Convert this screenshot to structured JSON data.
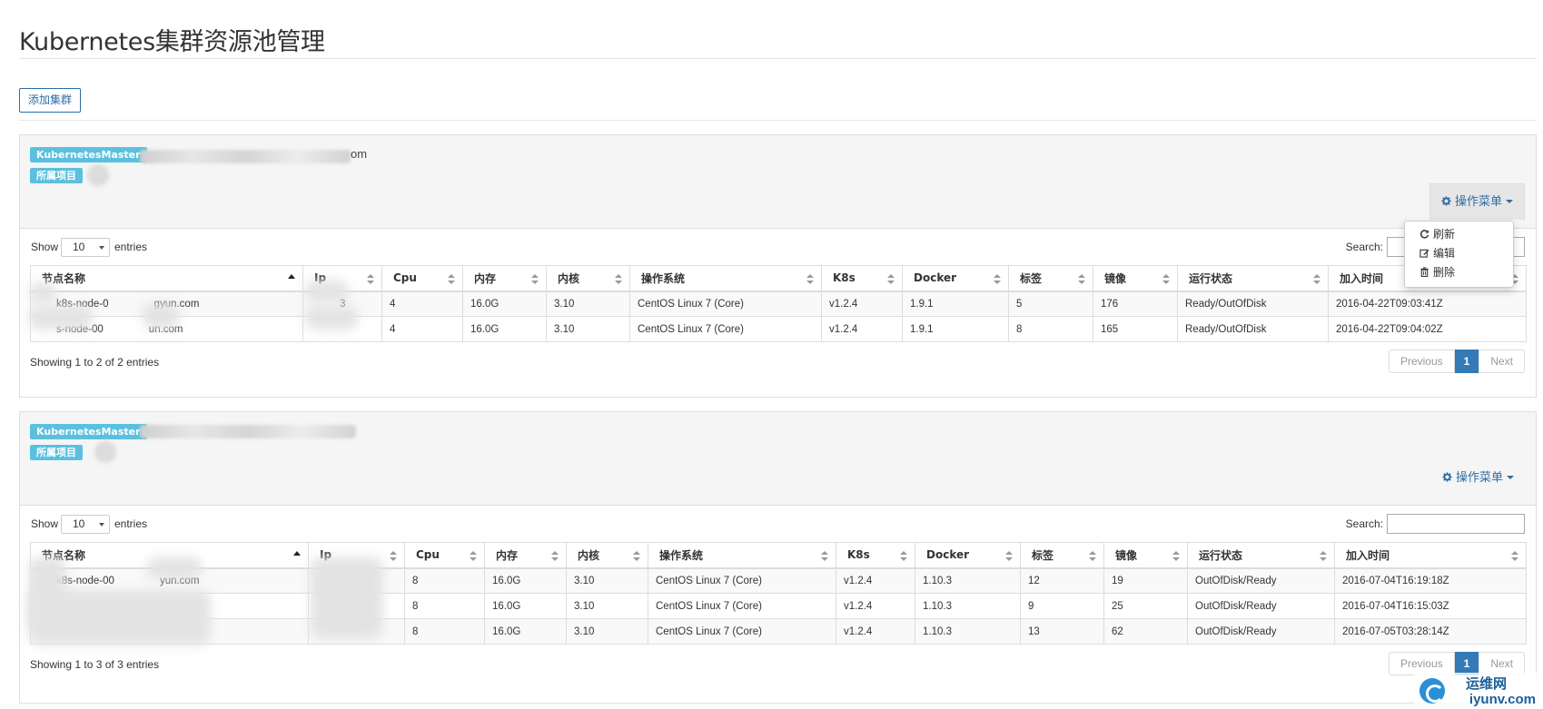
{
  "page": {
    "title": "Kubernetes集群资源池管理",
    "add_cluster_button": "添加集群"
  },
  "clusters": [
    {
      "master_label": "KubernetesMaster",
      "master_suffix": "om",
      "project_label": "所属项目",
      "ops_menu_label": "操作菜单",
      "show_label": "Show",
      "page_length": "10",
      "entries_label": "entries",
      "search_label": "Search:",
      "columns": [
        "节点名称",
        "Ip",
        "Cpu",
        "内存",
        "内核",
        "操作系统",
        "K8s",
        "Docker",
        "标签",
        "镜像",
        "运行状态",
        "加入时间"
      ],
      "rows": [
        [
          "k8s-node-0",
          "3",
          "4",
          "16.0G",
          "3.10",
          "CentOS Linux 7 (Core)",
          "v1.2.4",
          "1.9.1",
          "5",
          "176",
          "Ready/OutOfDisk",
          "2016-04-22T09:03:41Z"
        ],
        [
          "s-node-00",
          "",
          "4",
          "16.0G",
          "3.10",
          "CentOS Linux 7 (Core)",
          "v1.2.4",
          "1.9.1",
          "8",
          "165",
          "Ready/OutOfDisk",
          "2016-04-22T09:04:02Z"
        ]
      ],
      "row_suffixes": [
        "gyun.com",
        "un.com"
      ],
      "info": "Showing 1 to 2 of 2 entries",
      "pagination": {
        "previous": "Previous",
        "current": "1",
        "next": "Next"
      }
    },
    {
      "master_label": "KubernetesMaster",
      "project_label": "所属项目",
      "ops_menu_label": "操作菜单",
      "show_label": "Show",
      "page_length": "10",
      "entries_label": "entries",
      "search_label": "Search:",
      "columns": [
        "节点名称",
        "Ip",
        "Cpu",
        "内存",
        "内核",
        "操作系统",
        "K8s",
        "Docker",
        "标签",
        "镜像",
        "运行状态",
        "加入时间"
      ],
      "rows": [
        [
          "k8s-node-00",
          "",
          "8",
          "16.0G",
          "3.10",
          "CentOS Linux 7 (Core)",
          "v1.2.4",
          "1.10.3",
          "12",
          "19",
          "OutOfDisk/Ready",
          "2016-07-04T16:19:18Z"
        ],
        [
          "k8s-node-002",
          "",
          "8",
          "16.0G",
          "3.10",
          "CentOS Linux 7 (Core)",
          "v1.2.4",
          "1.10.3",
          "9",
          "25",
          "OutOfDisk/Ready",
          "2016-07-04T16:15:03Z"
        ],
        [
          "k8s-node-003",
          "",
          "8",
          "16.0G",
          "3.10",
          "CentOS Linux 7 (Core)",
          "v1.2.4",
          "1.10.3",
          "13",
          "62",
          "OutOfDisk/Ready",
          "2016-07-05T03:28:14Z"
        ]
      ],
      "row_suffixes": [
        "yun.com",
        "com",
        ""
      ],
      "info": "Showing 1 to 3 of 3 entries",
      "pagination": {
        "previous": "Previous",
        "current": "1",
        "next": "Next"
      }
    }
  ],
  "ops_dropdown": {
    "items": [
      {
        "label": "刷新",
        "icon": "refresh-icon"
      },
      {
        "label": "编辑",
        "icon": "edit-icon"
      },
      {
        "label": "删除",
        "icon": "trash-icon"
      }
    ]
  },
  "watermark": {
    "text": "运维网",
    "url": "iyunv.com"
  },
  "colors": {
    "label_bg": "#5bc0de",
    "primary": "#337ab7",
    "link": "#2e6da4",
    "panel_head_bg": "#f5f5f5"
  }
}
